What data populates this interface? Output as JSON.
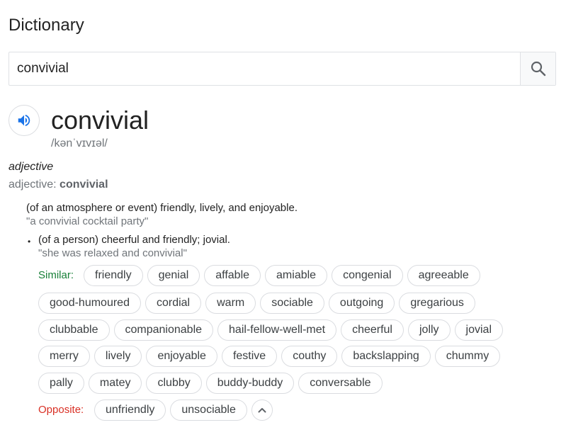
{
  "title": "Dictionary",
  "search": {
    "value": "convivial"
  },
  "entry": {
    "word": "convivial",
    "phonetic": "/kənˈvɪvɪəl/",
    "part_of_speech": "adjective",
    "pos_prefix": "adjective: ",
    "pos_word": "convivial",
    "definitions": [
      {
        "text": "(of an atmosphere or event) friendly, lively, and enjoyable.",
        "example": "\"a convivial cocktail party\""
      },
      {
        "bullet": "•",
        "text": "(of a person) cheerful and friendly; jovial.",
        "example": "\"she was relaxed and convivial\""
      }
    ],
    "similar_label": "Similar:",
    "similar_rows": [
      [
        "friendly",
        "genial",
        "affable",
        "amiable",
        "congenial",
        "agreeable"
      ],
      [
        "good-humoured",
        "cordial",
        "warm",
        "sociable",
        "outgoing",
        "gregarious"
      ],
      [
        "clubbable",
        "companionable",
        "hail-fellow-well-met",
        "cheerful",
        "jolly",
        "jovial"
      ],
      [
        "merry",
        "lively",
        "enjoyable",
        "festive",
        "couthy",
        "backslapping",
        "chummy"
      ],
      [
        "pally",
        "matey",
        "clubby",
        "buddy-buddy",
        "conversable"
      ]
    ],
    "opposite_label": "Opposite:",
    "opposites": [
      "unfriendly",
      "unsociable"
    ]
  }
}
